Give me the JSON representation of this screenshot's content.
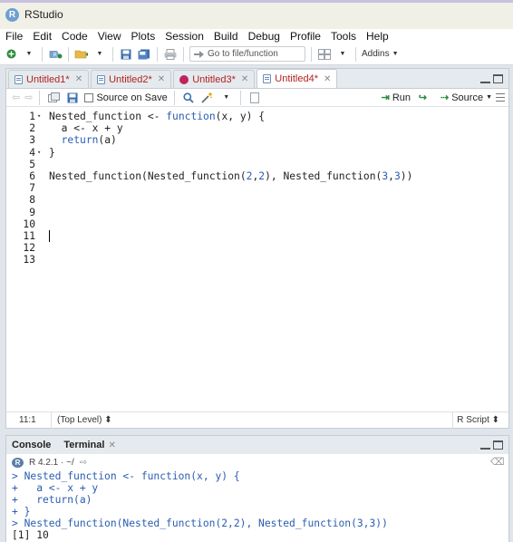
{
  "window": {
    "title": "RStudio",
    "logo_letter": "R"
  },
  "menu": [
    "File",
    "Edit",
    "Code",
    "View",
    "Plots",
    "Session",
    "Build",
    "Debug",
    "Profile",
    "Tools",
    "Help"
  ],
  "toolbar": {
    "goto_placeholder": "Go to file/function",
    "addins_label": "Addins"
  },
  "editor": {
    "tabs": [
      {
        "label": "Untitled1*",
        "icon": "r-script-icon",
        "active": false
      },
      {
        "label": "Untitled2*",
        "icon": "r-script-icon",
        "active": false
      },
      {
        "label": "Untitled3*",
        "icon": "record-icon",
        "active": false
      },
      {
        "label": "Untitled4*",
        "icon": "r-script-icon",
        "active": true
      }
    ],
    "source_on_save_label": "Source on Save",
    "run_label": "Run",
    "source_label": "Source",
    "lines": [
      {
        "num": "1",
        "fold": true,
        "parts": [
          [
            "Nested_function <- ",
            ""
          ],
          [
            "function",
            "kw"
          ],
          [
            "(x, y) {",
            ""
          ]
        ]
      },
      {
        "num": "2",
        "fold": false,
        "parts": [
          [
            "  a <- x + y",
            ""
          ]
        ]
      },
      {
        "num": "3",
        "fold": false,
        "parts": [
          [
            "  ",
            ""
          ],
          [
            "return",
            "kw"
          ],
          [
            "(a)",
            ""
          ]
        ]
      },
      {
        "num": "4",
        "fold": true,
        "parts": [
          [
            "}",
            ""
          ]
        ]
      },
      {
        "num": "5",
        "fold": false,
        "parts": []
      },
      {
        "num": "6",
        "fold": false,
        "parts": [
          [
            "Nested_function(Nested_function(",
            ""
          ],
          [
            "2",
            "num"
          ],
          [
            ",",
            ""
          ],
          [
            "2",
            "num"
          ],
          [
            "), Nested_function(",
            ""
          ],
          [
            "3",
            "num"
          ],
          [
            ",",
            ""
          ],
          [
            "3",
            "num"
          ],
          [
            "))",
            ""
          ]
        ]
      },
      {
        "num": "7",
        "fold": false,
        "parts": []
      },
      {
        "num": "8",
        "fold": false,
        "parts": []
      },
      {
        "num": "9",
        "fold": false,
        "parts": []
      },
      {
        "num": "10",
        "fold": false,
        "parts": []
      },
      {
        "num": "11",
        "fold": false,
        "parts": [],
        "cursor": true
      },
      {
        "num": "12",
        "fold": false,
        "parts": []
      },
      {
        "num": "13",
        "fold": false,
        "parts": []
      }
    ],
    "status": {
      "position": "11:1",
      "scope": "(Top Level) ⬍",
      "filetype": "R Script ⬍"
    }
  },
  "console": {
    "tabs": [
      "Console",
      "Terminal"
    ],
    "r_version": "R 4.2.1 · ~/",
    "lines": [
      {
        "text": "> Nested_function <- function(x, y) {",
        "kind": "input"
      },
      {
        "text": "+   a <- x + y",
        "kind": "input"
      },
      {
        "text": "+   return(a)",
        "kind": "input"
      },
      {
        "text": "+ }",
        "kind": "input"
      },
      {
        "text": "> Nested_function(Nested_function(2,2), Nested_function(3,3))",
        "kind": "input"
      },
      {
        "text": "[1] 10",
        "kind": "output"
      }
    ]
  }
}
